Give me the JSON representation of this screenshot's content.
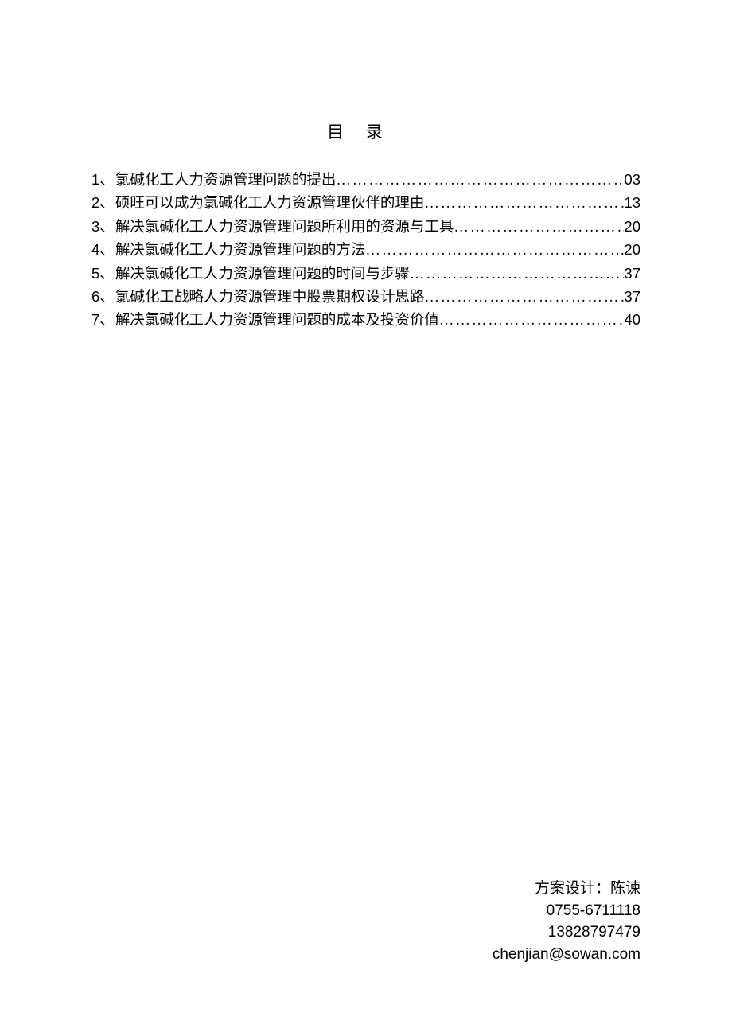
{
  "title": "目录",
  "toc": [
    {
      "num": "1",
      "sep": "、",
      "text": "氯碱化工人力资源管理问题的提出",
      "page": "03"
    },
    {
      "num": "2",
      "sep": "、",
      "text": "硕旺可以成为氯碱化工人力资源管理伙伴的理由",
      "page": "13"
    },
    {
      "num": "3",
      "sep": "、",
      "text": "解决氯碱化工人力资源管理问题所利用的资源与工具",
      "page": "20"
    },
    {
      "num": "4",
      "sep": "、",
      "text": "解决氯碱化工人力资源管理问题的方法",
      "page": "20"
    },
    {
      "num": "5",
      "sep": "、",
      "text": "解决氯碱化工人力资源管理问题的时间与步骤",
      "page": "37"
    },
    {
      "num": "6",
      "sep": "、",
      "text": "氯碱化工战略人力资源管理中股票期权设计思路",
      "page": "37"
    },
    {
      "num": "7",
      "sep": "、",
      "text": "解决氯碱化工人力资源管理问题的成本及投资价值",
      "page": "40"
    }
  ],
  "footer": {
    "designer_label": "方案设计：",
    "designer_name": "陈谏",
    "phone1": "0755-6711118",
    "phone2": "13828797479",
    "email": "chenjian@sowan.com"
  }
}
